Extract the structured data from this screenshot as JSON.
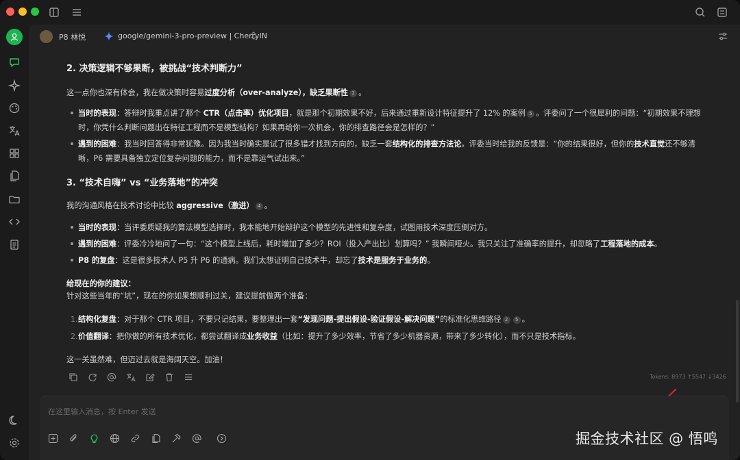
{
  "titlebar": {
    "icons": [
      "sidebar-toggle-icon",
      "menu-icon",
      "search-icon",
      "expand-icon"
    ]
  },
  "header": {
    "user": "P8 林悦",
    "model": "google/gemini-3-pro-preview | CherryIN"
  },
  "message": {
    "section2": {
      "title": "2. 决策逻辑不够果断，被挑战“技术判断力”",
      "intro_a": "这一点你也深有体会，我在做决策时容易",
      "intro_b": "过度分析（over-analyze），缺乏果断性",
      "intro_cite": "2",
      "intro_end": "。",
      "b1_l1_label": "当时的表现",
      "b1_l1_a": "：答辩时我重点讲了那个 ",
      "b1_l1_b": "CTR（点击率）优化项目",
      "b1_l1_c": "，就是那个初期效果不好，后来通过重新设计特征提升了 12% 的案例",
      "b1_l1_cite": "5",
      "b1_l1_d": "。评委问了一个很犀利的问题：“初期效果不理想",
      "b1_l2": "时，你凭什么判断问题出在特征工程而不是模型结构？如果再给你一次机会，你的排查路径会是怎样的？”",
      "b2_l1_label": "遇到的困难",
      "b2_l1_a": "：我当时回答得非常犹豫。因为我当时确实是试了很多错才找到方向的，缺乏一套",
      "b2_l1_b": "结构化的排查方法论",
      "b2_l1_c": "。评委当时给我的反馈是：“你的结果很好，但你的",
      "b2_l1_d": "技术直觉",
      "b2_l1_e": "还不够清",
      "b2_l2": "晰，P6 需要具备独立定位复杂问题的能力，而不是靠运气试出来。”"
    },
    "section3": {
      "title": "3. “技术自嗨” vs “业务落地”的冲突",
      "intro_a": "我的沟通风格在技术讨论中比较 ",
      "intro_b": "aggressive（激进）",
      "intro_cite": "4",
      "intro_end": "。",
      "b1_label": "当时的表现",
      "b1_text": "：当评委质疑我的算法模型选择时，我本能地开始辩护这个模型的先进性和复杂度，试图用技术深度压倒对方。",
      "b2_label": "遇到的困难",
      "b2_a": "：评委冷冷地问了一句：“这个模型上线后，耗时增加了多少？ROI（投入产出比）划算吗？” 我瞬间哑火。我只关注了准确率的提升，却忽略了",
      "b2_b": "工程落地的成本",
      "b2_c": "。",
      "b3_label": "P8 的复盘",
      "b3_a": "：这是很多技术人 P5 升 P6 的通病。我们太想证明自己技术牛，却忘了",
      "b3_b": "技术是服务于业务的",
      "b3_c": "。"
    },
    "advice": {
      "title": "给现在的你的建议：",
      "intro": "针对这些当年的“坑”，现在的你如果想顺利过关，建议提前做两个准备：",
      "n1": "1.",
      "i1_label": "结构化复盘",
      "i1_a": "：对于那个 CTR 项目，不要只记结果，要整理出一套",
      "i1_b": "“发现问题-提出假设-验证假设-解决问题”",
      "i1_c": "的标准化思维路径",
      "i1_cite1": "2",
      "i1_cite2": "5",
      "i1_end": "。",
      "n2": "2.",
      "i2_label": "价值翻译",
      "i2_a": "：把你做的所有技术优化，都尝试翻译成",
      "i2_b": "业务收益",
      "i2_c": "（比如：提升了多少效率，节省了多少机器资源，带来了多少转化），而不只是技术指标。"
    },
    "closing": "这一关虽然难，但迈过去就是海阔天空。加油！"
  },
  "tokens": "Tokens: 8973 ↑5547 ↓3426",
  "input": {
    "placeholder": "在这里输入消息，按 Enter 发送"
  },
  "watermark": "掘金技术社区 @ 悟鸣",
  "colors": {
    "accent": "#1fb350",
    "background": "#222222",
    "arrow": "#d9262c"
  }
}
